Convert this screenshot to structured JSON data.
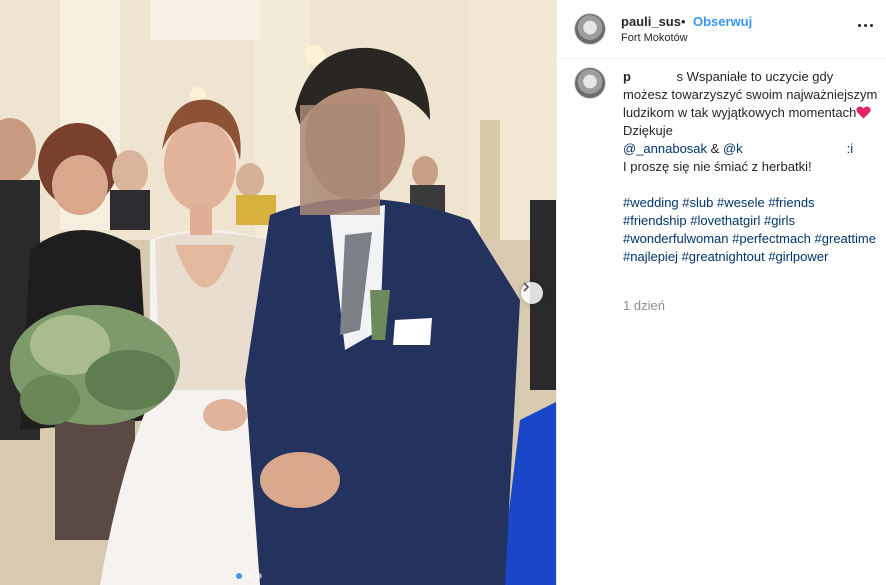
{
  "post": {
    "username": "pauli_sus",
    "bullet": "•",
    "follow_label": "Obserwuj",
    "location": "Fort Mokotów",
    "more_icon": "more-horizontal-icon"
  },
  "caption": {
    "user_visible": "p",
    "text_line1": "s Wspaniałe to uczycie gdy możesz towarzyszyć swoim najważniejszym ludzikom w tak wyjątkowych momentach",
    "text_after_heart": " Dziękuje",
    "mention1": "@_annabosak",
    "amp": " & ",
    "mention2_visible": "@k",
    "mention2_tail": ":i",
    "line_last": "I proszę się nie śmiać z herbatki!",
    "hashtags": [
      "#wedding",
      "#slub",
      "#wesele",
      "#friends",
      "#friendship",
      "#lovethatgirl",
      "#girls",
      "#wonderfulwoman",
      "#perfectmach",
      "#greattime",
      "#najlepiej",
      "#greatnightout",
      "#girlpower"
    ],
    "time": "1 dzień"
  },
  "colors": {
    "follow": "#3897f0",
    "hashtag": "#003569",
    "heart": "#e0245e",
    "muted": "#8e8e8e"
  }
}
